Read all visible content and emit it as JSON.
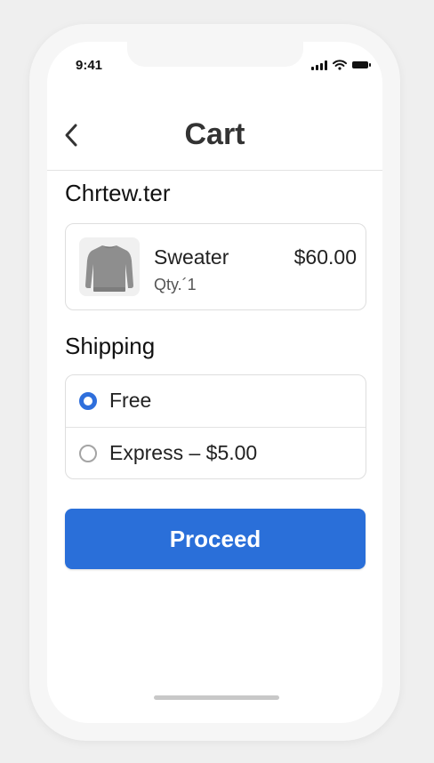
{
  "status_bar": {
    "time": "9:41"
  },
  "header": {
    "title": "Cart",
    "back_icon": "chevron-left-icon"
  },
  "cart": {
    "section_heading": "Chrtew.ter",
    "item": {
      "name": "Sweater",
      "quantity": "Qty.´1",
      "price": "$60.00",
      "thumbnail_icon": "sweater-icon"
    }
  },
  "shipping": {
    "heading": "Shipping",
    "options": [
      {
        "label": "Free",
        "selected": true
      },
      {
        "label": "Express – $5.00",
        "selected": false
      }
    ]
  },
  "actions": {
    "proceed_label": "Proceed"
  },
  "colors": {
    "accent": "#2a6fd9",
    "text": "#222222",
    "border": "#dedede"
  }
}
